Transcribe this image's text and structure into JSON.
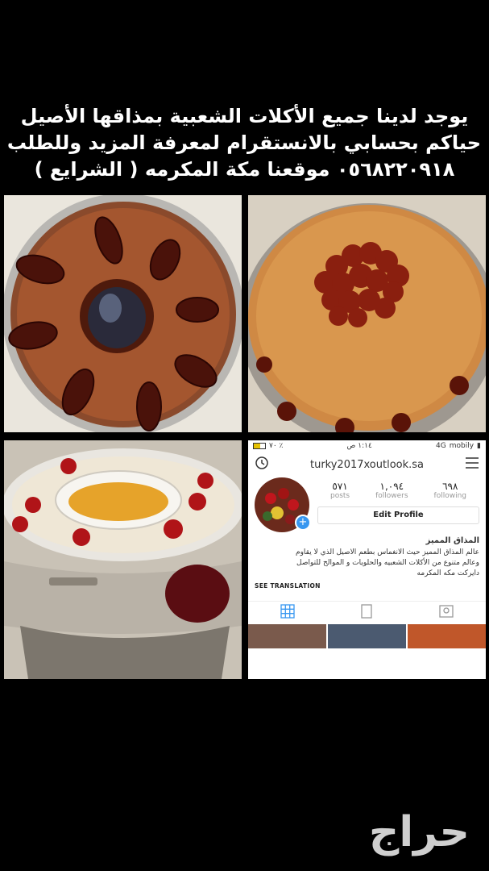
{
  "caption": {
    "line1": "يوجد لدينا جميع الأكلات الشعبية بمذاقها الأصيل",
    "line2": "حياكم بحسابي بالانستقرام لمعرفة المزيد وللطلب",
    "line3": "٠٥٦٨٢٢٠٩١٨  موقعنا مكة المكرمه  ( الشرايع )"
  },
  "phone": {
    "status": {
      "battery": "٧٠ ٪",
      "time": "١:١٤ ص",
      "network": "4G",
      "carrier": "mobily"
    },
    "username": "turky2017xoutlook.sa",
    "stats": [
      {
        "num": "٥٧١",
        "label": "posts"
      },
      {
        "num": "١,٠٩٤",
        "label": "followers"
      },
      {
        "num": "٦٩٨",
        "label": "following"
      }
    ],
    "edit_profile": "Edit Profile",
    "bio_name": "المذاق المميز",
    "bio_line1": "عالم المذاق المميز حيث الانغماس بطعم الاصيل الذي لا يقاوم",
    "bio_line2": "وعالم متنوع من الأكلات الشعبيه والحلويات و الموالح للتواصل",
    "bio_line3": "دايركت مكه المكرمه",
    "see_translation": "SEE TRANSLATION"
  },
  "logo_text": "حراج",
  "icons": [
    "history-icon",
    "menu-icon",
    "grid-icon",
    "list-icon",
    "tagged-icon",
    "add-badge-icon"
  ]
}
